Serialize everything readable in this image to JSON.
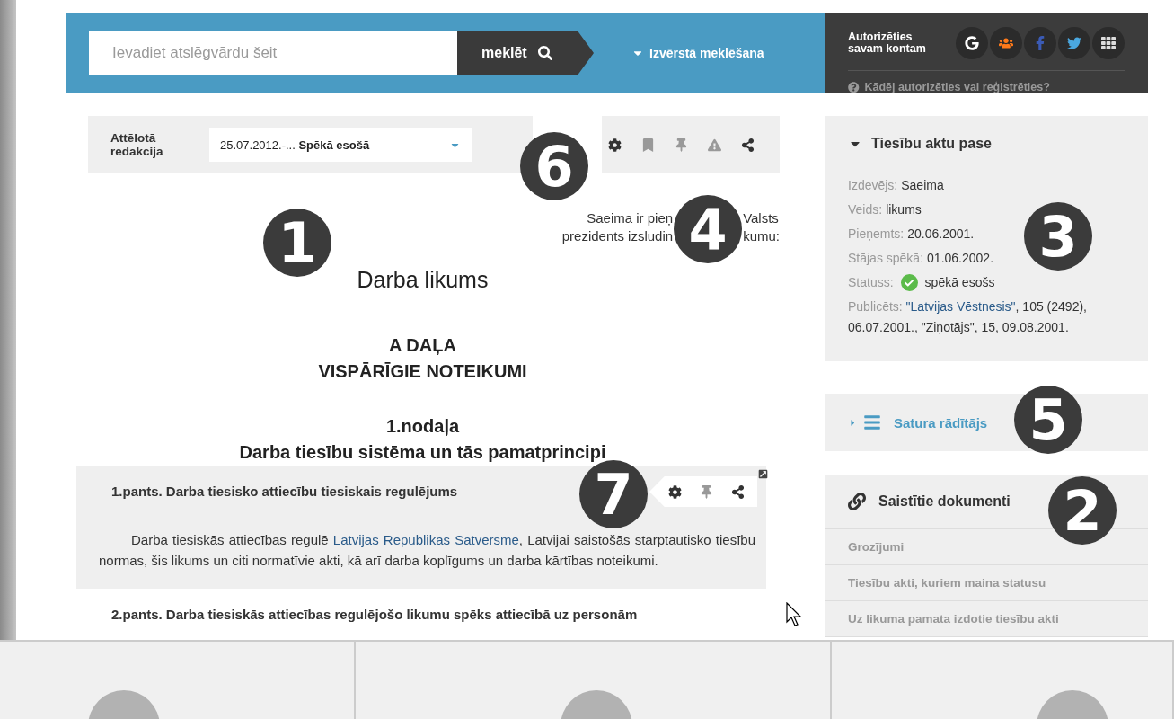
{
  "header": {
    "search": {
      "placeholder": "Ievadiet atslēgvārdu šeit"
    },
    "search_button": "meklēt",
    "advanced_search": {
      "label": "Izvērstā meklēšana",
      "expanded": false
    },
    "auth_label": "Autorizēties savam kontam",
    "auth_help": "Kādēj autorizēties vai reģistrēties?"
  },
  "edition_bar": {
    "label": "Attēlotā redakcija",
    "value": "25.07.2012.-... **Spēkā esošā**"
  },
  "document": {
    "intro": [
      [
        "Saeima ir pieņ",
        "Valsts"
      ],
      [
        "prezidents izsludin",
        "kumu:"
      ]
    ],
    "title": "Darba likums",
    "part": [
      "A DAĻA",
      "VISPĀRĪGIE NOTEIKUMI"
    ],
    "chapter": [
      "1.nodaļa",
      "Darba tiesību sistēma un tās pamatprincipi"
    ],
    "articles": [
      {
        "title": "1.pants. Darba tiesisko attiecību tiesiskais regulējums",
        "highlighted": true,
        "body_before": "Darba tiesiskās attiecības regulē ",
        "link": "Latvijas Republikas Satversme",
        "body_after": ", Latvijai saistošās starptautisko tiesību normas, šis likums un citi normatīvie akti, kā arī darba koplīgums un darba kārtības noteikumi."
      },
      {
        "title": "2.pants. Darba tiesiskās attiecības regulējošo likumu spēks attiecībā uz personām",
        "highlighted": false
      }
    ]
  },
  "passport": {
    "title": "Tiesību aktu pase",
    "expanded": true,
    "rows": [
      {
        "label": "Izdevējs:",
        "value": "Saeima"
      },
      {
        "label": "Veids:",
        "value": "likums"
      },
      {
        "label": "Pieņemts:",
        "value": "20.06.2001."
      },
      {
        "label": "Stājas spēkā:",
        "value": "01.06.2002."
      },
      {
        "label": "Statuss:",
        "value": "spēkā esošs",
        "kind": "status"
      }
    ],
    "published": {
      "label": "Publicēts:",
      "link": "\"Latvijas Vēstnesis\"",
      "rest": ", 105 (2492), 06.07.2001., \"Ziņotājs\", 15, 09.08.2001."
    }
  },
  "contents": {
    "label": "Satura rādītājs",
    "expanded": false
  },
  "related": {
    "title": "Saistītie dokumenti",
    "items": [
      "Grozījumi",
      "Tiesību akti, kuriem maina statusu",
      "Uz likuma pamata izdotie tiesību akti"
    ]
  },
  "callouts": [
    "1",
    "6",
    "4",
    "3",
    "5",
    "2",
    "7"
  ]
}
